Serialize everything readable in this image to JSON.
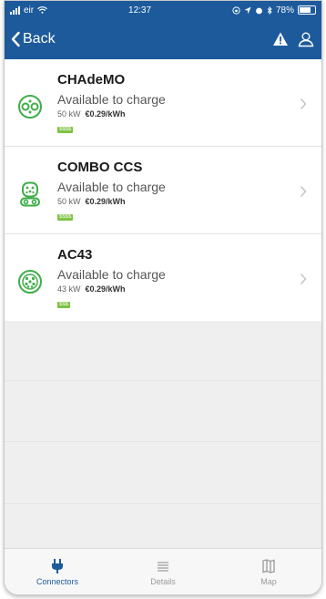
{
  "status_bar": {
    "carrier": "eir",
    "time": "12:37",
    "battery": "78%"
  },
  "nav": {
    "back_label": "Back"
  },
  "connectors": [
    {
      "name": "CHAdeMO",
      "status": "Available to charge",
      "power": "50 kW",
      "price": "€0.29/kWh",
      "speed_badge": "$$$$"
    },
    {
      "name": "COMBO CCS",
      "status": "Available to charge",
      "power": "50 kW",
      "price": "€0.29/kWh",
      "speed_badge": "$$$$"
    },
    {
      "name": "AC43",
      "status": "Available to charge",
      "power": "43 kW",
      "price": "€0.29/kWh",
      "speed_badge": "$$$"
    }
  ],
  "tabs": [
    {
      "label": "Connectors",
      "icon": "plug-icon",
      "active": true
    },
    {
      "label": "Details",
      "icon": "list-icon",
      "active": false
    },
    {
      "label": "Map",
      "icon": "map-icon",
      "active": false
    }
  ],
  "colors": {
    "header": "#1d5a9c",
    "connector_green": "#3fae49",
    "badge_green": "#7dc241",
    "tab_active": "#1d5a9c"
  }
}
